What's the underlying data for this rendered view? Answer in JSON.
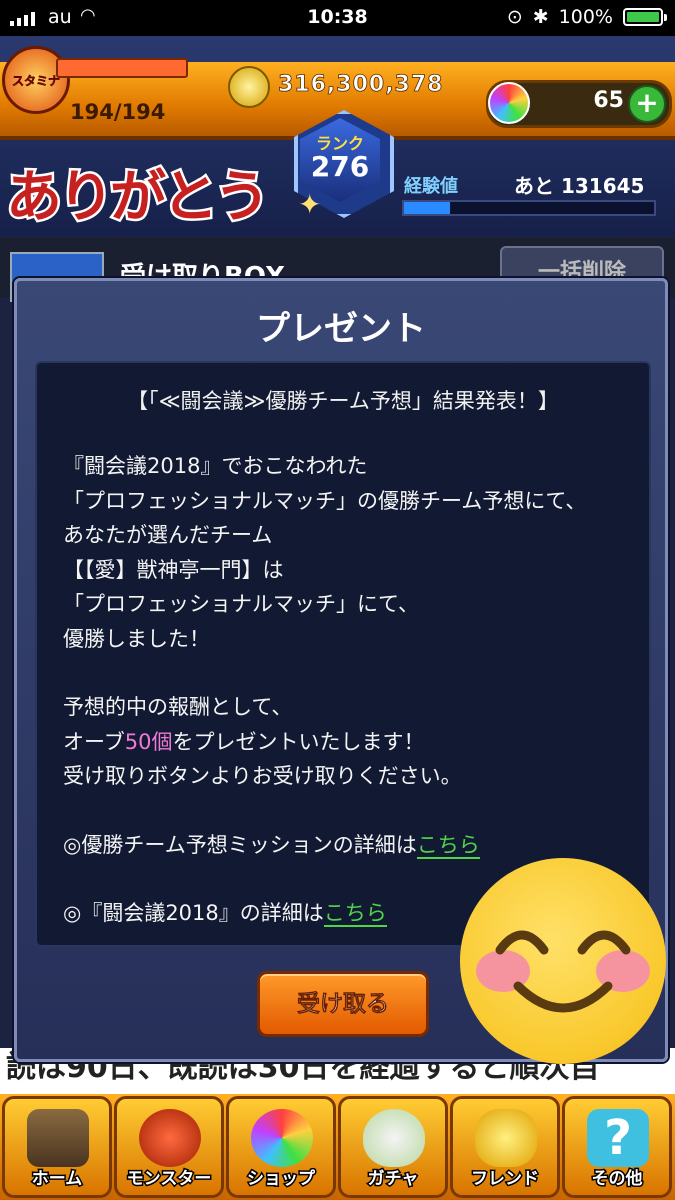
{
  "statusbar": {
    "carrier": "au",
    "time": "10:38",
    "battery": "100%",
    "battery_level": 1.0
  },
  "hud": {
    "stamina_label": "スタミナ",
    "stamina_value": "194/194",
    "gold": "316,300,378",
    "orbs": "65",
    "rank_label": "ランク",
    "rank_value": "276",
    "exp_label": "経験値",
    "exp_remaining": "あと 131645"
  },
  "overlay": {
    "thanks_text": "ありがとう"
  },
  "background": {
    "page_title": "受け取りBOX",
    "bulk_delete_label": "一括削除",
    "notice_text": "読は90日、既読は30日を経過すると順次自"
  },
  "modal": {
    "title": "プレゼント",
    "headline": "【「≪闘会議≫優勝チーム予想」結果発表！】",
    "body_1": "『闘会議2018』でおこなわれた",
    "body_2": "「プロフェッショナルマッチ」の優勝チーム予想にて、",
    "body_3": "あなたが選んだチーム",
    "body_4": "【【愛】獣神亭一門】は",
    "body_5": "「プロフェッショナルマッチ」にて、",
    "body_6": "優勝しました！",
    "body_7": "予想的中の報酬として、",
    "body_8a": "オーブ",
    "body_8b": "50個",
    "body_8c": "をプレゼントいたします！",
    "body_9": "受け取りボタンよりお受け取りください。",
    "mission_text": "◎優勝チーム予想ミッションの詳細は",
    "mission_link": "こちら",
    "event_text": "◎『闘会議2018』の詳細は",
    "event_link": "こちら",
    "receive_button": "受け取る"
  },
  "nav": {
    "home": "ホーム",
    "monster": "モンスター",
    "shop": "ショップ",
    "gacha": "ガチャ",
    "friend": "フレンド",
    "other": "その他"
  }
}
